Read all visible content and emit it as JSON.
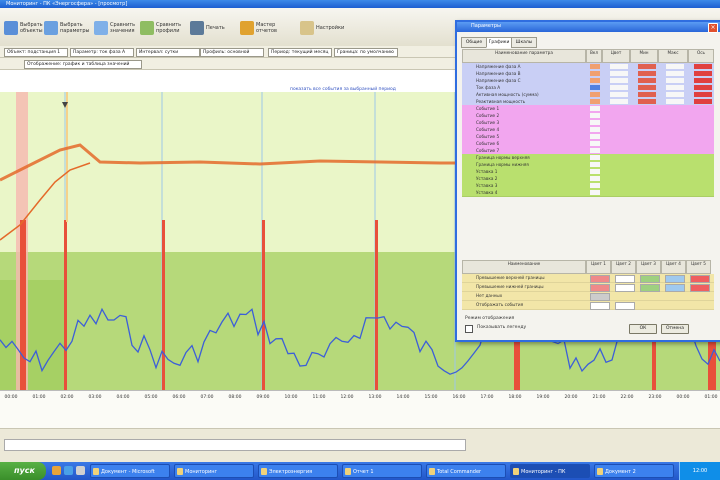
{
  "window": {
    "title": "Мониторинг - ПК «Энергосфера» - [просмотр]"
  },
  "toolbar": {
    "buttons": [
      {
        "label": "Выбрать объекты",
        "icon": "objects-icon",
        "color": "#5a8fd8"
      },
      {
        "label": "Выбрать параметры",
        "icon": "params-icon",
        "color": "#6aa0e0"
      },
      {
        "label": "Сравнить значения",
        "icon": "compare-icon",
        "color": "#7fb0e8"
      },
      {
        "label": "Сравнить профили",
        "icon": "profiles-icon",
        "color": "#8fbd62"
      },
      {
        "label": "Печать",
        "icon": "print-icon",
        "color": "#5c7a99"
      },
      {
        "label": "Мастер отчетов",
        "icon": "report-wizard-icon",
        "color": "#e0a22f"
      },
      {
        "label": "Настройки",
        "icon": "settings-icon",
        "color": "#d8c48a"
      }
    ]
  },
  "filters": {
    "row1": [
      "Объект: подстанция 1",
      "Параметр: ток фаза А",
      "Интервал: сутки",
      "Профиль: основной",
      "Период: текущий месяц",
      "Граница: по умолчанию"
    ],
    "row2": [
      "Отображение: график и таблица значений"
    ]
  },
  "chart": {
    "link_text": "показать все события за выбранный период",
    "x_ticks": [
      "00:00",
      "01:00",
      "02:00",
      "03:00",
      "04:00",
      "05:00",
      "06:00",
      "07:00",
      "08:00",
      "09:00",
      "10:00",
      "11:00",
      "12:00",
      "13:00",
      "14:00",
      "15:00",
      "16:00",
      "17:00",
      "18:00",
      "19:00",
      "20:00",
      "21:00",
      "22:00",
      "23:00",
      "00:00",
      "01:00"
    ],
    "colors": {
      "upper_band": "#eaf6c8",
      "lower_band": "#b6d97a",
      "red_marker": "#e8503a",
      "blue_line": "#3c5fd8",
      "orange_line": "#e46a2a"
    }
  },
  "dialog": {
    "title": "Параметры",
    "tabs": [
      "Общие",
      "Графики",
      "Шкалы"
    ],
    "grid_headers": [
      "Наименование параметра",
      "Вкл",
      "Цвет",
      "Мин",
      "Макс",
      "Ось"
    ],
    "rows": [
      {
        "label": "Напряжение фаза А",
        "band": "#c9cff5",
        "cells": [
          "#f0a070",
          "#f7f7f7",
          "#e06050",
          "#f7f7f7",
          "#e04040"
        ]
      },
      {
        "label": "Напряжение фаза В",
        "band": "#c9cff5",
        "cells": [
          "#f0a070",
          "#f7f7f7",
          "#e06050",
          "#f7f7f7",
          "#e04040"
        ]
      },
      {
        "label": "Напряжение фаза С",
        "band": "#c9cff5",
        "cells": [
          "#f0a070",
          "#f7f7f7",
          "#e06050",
          "#f7f7f7",
          "#e04040"
        ]
      },
      {
        "label": "Ток фаза А",
        "band": "#c9cff5",
        "cells": [
          "#5080e0",
          "#f7f7f7",
          "#e06050",
          "#f7f7f7",
          "#e04040"
        ]
      },
      {
        "label": "Активная мощность (сумма)",
        "band": "#c9cff5",
        "cells": [
          "#f0a070",
          "#f7f7f7",
          "#e06050",
          "#f7f7f7",
          "#e04040"
        ]
      },
      {
        "label": "Реактивная мощность",
        "band": "#c9cff5",
        "cells": [
          "#f0a070",
          "#f7f7f7",
          "#e06050",
          "#f7f7f7",
          "#e04040"
        ]
      },
      {
        "label": "Событие 1",
        "band": "#f2a6ef",
        "cells": [
          "#f7f7f7"
        ]
      },
      {
        "label": "Событие 2",
        "band": "#f2a6ef",
        "cells": [
          "#f7f7f7"
        ]
      },
      {
        "label": "Событие 3",
        "band": "#f2a6ef",
        "cells": [
          "#f7f7f7"
        ]
      },
      {
        "label": "Событие 4",
        "band": "#f2a6ef",
        "cells": [
          "#f7f7f7"
        ]
      },
      {
        "label": "Событие 5",
        "band": "#f2a6ef",
        "cells": [
          "#f7f7f7"
        ]
      },
      {
        "label": "Событие 6",
        "band": "#f2a6ef",
        "cells": [
          "#f7f7f7"
        ]
      },
      {
        "label": "Событие 7",
        "band": "#f2a6ef",
        "cells": [
          "#f7f7f7"
        ]
      },
      {
        "label": "Граница нормы верхняя",
        "band": "#b9e06e",
        "cells": [
          "#f7f7f7"
        ]
      },
      {
        "label": "Граница нормы нижняя",
        "band": "#b9e06e",
        "cells": [
          "#f7f7f7"
        ]
      },
      {
        "label": "Уставка 1",
        "band": "#b9e06e",
        "cells": [
          "#f7f7f7"
        ]
      },
      {
        "label": "Уставка 2",
        "band": "#b9e06e",
        "cells": [
          "#f7f7f7"
        ]
      },
      {
        "label": "Уставка 3",
        "band": "#b9e06e",
        "cells": [
          "#f7f7f7"
        ]
      },
      {
        "label": "Уставка 4",
        "band": "#b9e06e",
        "cells": [
          "#f7f7f7"
        ]
      }
    ],
    "lower_headers": [
      "Наименование",
      "Цвет 1",
      "Цвет 2",
      "Цвет 3",
      "Цвет 4",
      "Цвет 5"
    ],
    "lower_rows": [
      {
        "label": "Превышение верхней границы",
        "band": "#f2e6a8",
        "cells": [
          "#ef8a8a",
          "#ffffff",
          "#9fd080",
          "#9fc9ef",
          "#ef6060"
        ]
      },
      {
        "label": "Превышение нижней границы",
        "band": "#f2e6a8",
        "cells": [
          "#ef8a8a",
          "#ffffff",
          "#9fd080",
          "#9fc9ef",
          "#ef6060"
        ]
      },
      {
        "label": "Нет данных",
        "band": "#f2e6a8",
        "cells": [
          "#cccccc"
        ]
      },
      {
        "label": "Отображать события",
        "band": "#f2e6a8",
        "cells": [
          "#ffffff",
          "#ffffff"
        ]
      }
    ],
    "footer_label": "Режим отображения",
    "footer_checkbox": "Показывать легенду",
    "ok_label": "ОК",
    "cancel_label": "Отмена"
  },
  "taskbar": {
    "start": "пуск",
    "tasks": [
      "Документ - Microsoft",
      "Мониторинг",
      "Электроэнергия",
      "Отчет 1",
      "Total Commander",
      "Мониторинг - ПК",
      "Документ 2"
    ],
    "active_index": 5,
    "clock": "12:00"
  }
}
